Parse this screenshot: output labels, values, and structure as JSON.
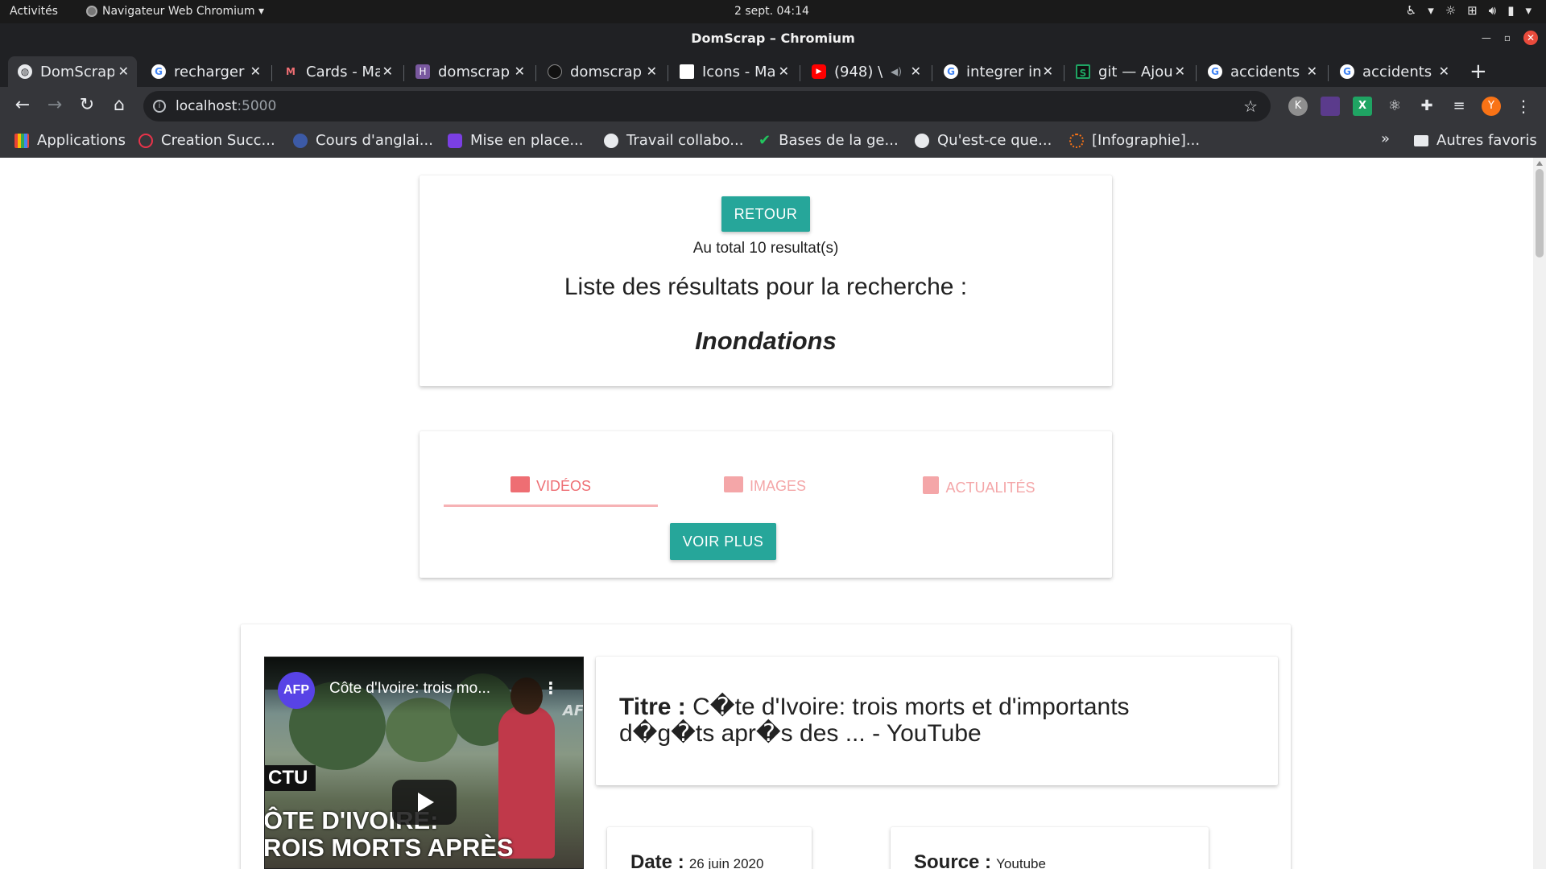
{
  "system_bar": {
    "activities": "Activités",
    "app_name": "Navigateur Web Chromium ▾",
    "clock": "2 sept.  04:14"
  },
  "window": {
    "title": "DomScrap – Chromium"
  },
  "tabs": [
    {
      "label": "DomScrap",
      "icon": "globe-icon",
      "color": "#e8eaed"
    },
    {
      "label": "recharger",
      "icon": "google-icon",
      "color": "#4285f4"
    },
    {
      "label": "Cards - Ma",
      "icon": "materialize-icon",
      "color": "#ee6e73"
    },
    {
      "label": "domscrap",
      "icon": "heroku-icon",
      "color": "#79589f"
    },
    {
      "label": "domscrap",
      "icon": "github-icon",
      "color": "#333333"
    },
    {
      "label": "Icons - Ma",
      "icon": "materialize-icon",
      "color": "#ffffff"
    },
    {
      "label": "(948) \\",
      "icon": "youtube-icon",
      "color": "#ff0000"
    },
    {
      "label": "integrer in",
      "icon": "google-icon",
      "color": "#4285f4"
    },
    {
      "label": "git — Ajou",
      "icon": "stackshare-icon",
      "color": "#1fa463"
    },
    {
      "label": "accidents",
      "icon": "google-icon",
      "color": "#4285f4"
    },
    {
      "label": "accidents",
      "icon": "google-icon",
      "color": "#4285f4"
    }
  ],
  "address": {
    "host": "localhost",
    "port": ":5000"
  },
  "toolbar": {
    "profile_initial": "Y",
    "ext_k": "K"
  },
  "bookmarks": [
    {
      "label": "Applications",
      "icon": "apps-grid-icon",
      "color": "#ea4335"
    },
    {
      "label": "Creation Succ...",
      "icon": "bookmark-icon",
      "color": "#e8334a"
    },
    {
      "label": "Cours d'anglai...",
      "icon": "flag-icon",
      "color": "#3c5aa6"
    },
    {
      "label": "Mise en place...",
      "icon": "bookmark-icon",
      "color": "#7b3fe4"
    },
    {
      "label": "Travail collabo...",
      "icon": "globe-icon",
      "color": "#e8eaed"
    },
    {
      "label": "Bases de la ge...",
      "icon": "check-icon",
      "color": "#22c55e"
    },
    {
      "label": "Qu'est-ce que...",
      "icon": "globe-icon",
      "color": "#e8eaed"
    },
    {
      "label": "[Infographie]...",
      "icon": "loader-icon",
      "color": "#f97316"
    }
  ],
  "bookmarks_more": "»",
  "other_bookmarks": "Autres favoris",
  "header_card": {
    "back_button": "RETOUR",
    "total": "Au total 10 resultat(s)",
    "heading": "Liste des résultats pour la recherche :",
    "query": "Inondations"
  },
  "media_tabs": {
    "items": [
      {
        "label": "VIDÉOS",
        "icon": "movie-icon",
        "active": true
      },
      {
        "label": "IMAGES",
        "icon": "image-icon",
        "active": false
      },
      {
        "label": "ACTUALITÉS",
        "icon": "article-icon",
        "active": false
      }
    ],
    "more_button": "VOIR PLUS"
  },
  "result": {
    "video": {
      "channel": "AFP",
      "title": "Côte d'Ivoire: trois mo...",
      "watermark": "AF",
      "tag": "CTU",
      "headline_line1": "ÔTE D'IVOIRE:",
      "headline_line2": "ROIS MORTS APRÈS"
    },
    "title_label": "Titre :",
    "title_text": "C�te d'Ivoire: trois morts et d'importants d�g�ts apr�s des ... - YouTube",
    "date_label": "Date :",
    "date_value": "26 juin 2020",
    "source_label": "Source :",
    "source_value": "Youtube"
  },
  "colors": {
    "teal": "#26a69a",
    "tab_red": "#ee6e73",
    "chrome_dark": "#202124",
    "chrome_toolbar": "#35363a"
  }
}
